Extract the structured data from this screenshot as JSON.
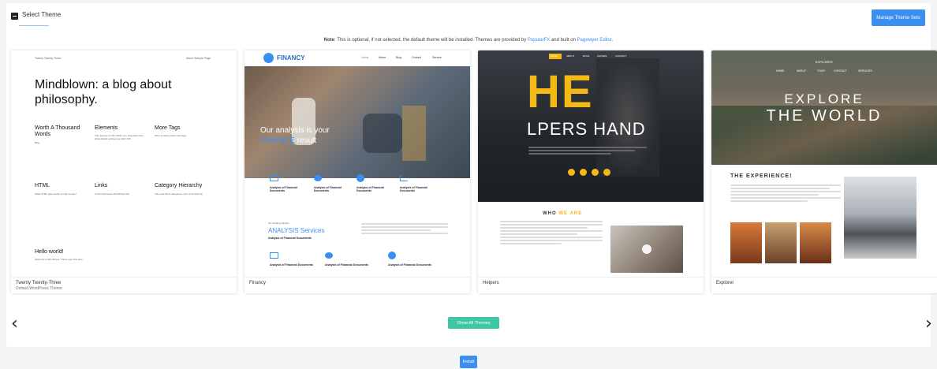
{
  "header": {
    "title": "Select Theme",
    "manage_label": "Manage Theme Sets"
  },
  "note": {
    "prefix": "Note",
    "text": ": This is optional, if not selected, the default theme will be installed. Themes are provided by ",
    "link1": "PopularFX",
    "mid": " and built on ",
    "link2": "Pagelayer Editor",
    "end": "."
  },
  "themes": [
    {
      "name": "Twenty Twenty-Three",
      "sub": "Default WordPress Theme",
      "preview": {
        "site_title": "Twenty Twenty-Three",
        "nav": "About  Sample Page",
        "headline": "Mindblown: a blog about philosophy.",
        "posts": [
          {
            "title": "Worth A Thousand Words",
            "meta": "Blog"
          },
          {
            "title": "Elements",
            "meta": "The purpose of this HTML is to help determine what default settings are with CSS"
          },
          {
            "title": "More Tags",
            "meta": "More of these posts need tags"
          },
          {
            "title": "HTML",
            "meta": "What HTML tags would you like to see?"
          },
          {
            "title": "Links",
            "meta": "In the well known WordPress title"
          },
          {
            "title": "Category Hierarchy",
            "meta": "This post has 4 categories, part of a hierarchy"
          },
          {
            "title": "Hello world!",
            "meta": "Welcome to WordPress. This is your first post."
          }
        ]
      }
    },
    {
      "name": "Financy",
      "sub": "",
      "preview": {
        "logo": "FINANCY",
        "nav": [
          "Home",
          "About",
          "Blog",
          "Contact",
          "Service"
        ],
        "hero_line1": "Our analysis is your",
        "hero_line2_hl": "FINANCE",
        "hero_line2_rest": " result",
        "feature_title": "Analysis of Financial Documents",
        "services_kicker": "Our leading solution",
        "services_hl": "ANALYSIS",
        "services_rest": " Services",
        "services_sub": "Analysis of Financial Documents"
      }
    },
    {
      "name": "Helpers",
      "sub": "",
      "preview": {
        "nav": [
          "HOME",
          "ABOUT",
          "BLOG",
          "CAUSES",
          "CONTACT"
        ],
        "big": "HE",
        "line2": "LPERS HAND",
        "who_pre": "WHO ",
        "who_hl": "WE ARE"
      }
    },
    {
      "name": "Explorer",
      "sub": "",
      "preview": {
        "brand": "EXPLORER",
        "nav": [
          "HOME",
          "ABOUT",
          "TOUR",
          "CONTACT",
          "SERVICES"
        ],
        "hero1": "EXPLORE",
        "hero2": "THE WORLD",
        "exp_title": "THE EXPERIENCE!"
      }
    }
  ],
  "controls": {
    "prev": "‹",
    "next": "›",
    "show_all": "Show All Themes",
    "install": "Install"
  },
  "colors": {
    "accent_blue": "#3b8ff0",
    "teal": "#3ec7a7",
    "helpers_yellow": "#f5b915"
  }
}
